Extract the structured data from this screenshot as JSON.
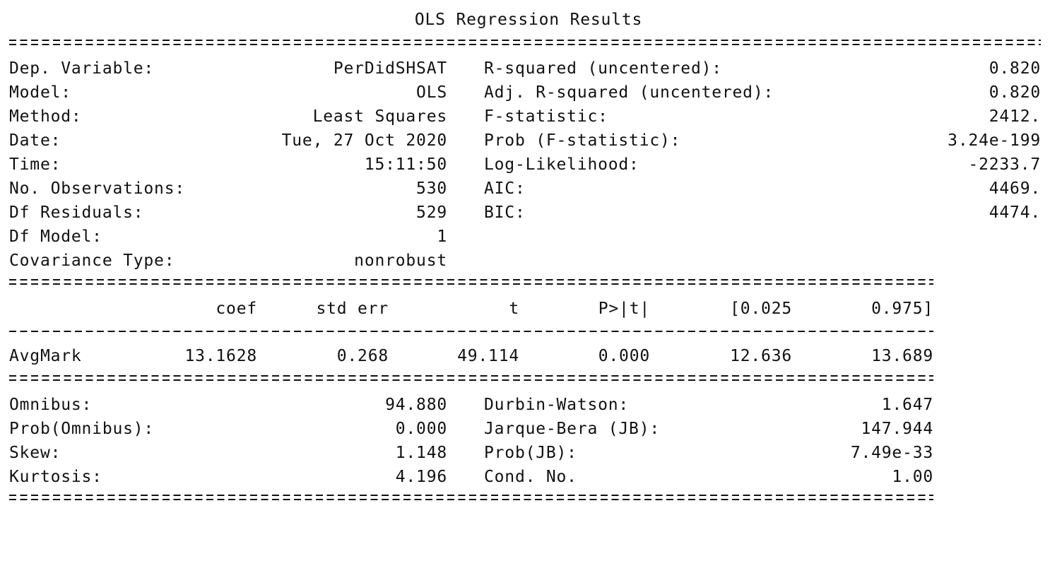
{
  "title": "OLS Regression Results",
  "model_info": {
    "left": [
      {
        "label": "Dep. Variable:",
        "value": "PerDidSHSAT"
      },
      {
        "label": "Model:",
        "value": "OLS"
      },
      {
        "label": "Method:",
        "value": "Least Squares"
      },
      {
        "label": "Date:",
        "value": "Tue, 27 Oct 2020"
      },
      {
        "label": "Time:",
        "value": "15:11:50"
      },
      {
        "label": "No. Observations:",
        "value": "530"
      },
      {
        "label": "Df Residuals:",
        "value": "529"
      },
      {
        "label": "Df Model:",
        "value": "1"
      },
      {
        "label": "Covariance Type:",
        "value": "nonrobust"
      }
    ],
    "right": [
      {
        "label": "R-squared (uncentered):",
        "value": "0.820"
      },
      {
        "label": "Adj. R-squared (uncentered):",
        "value": "0.820"
      },
      {
        "label": "F-statistic:",
        "value": "2412."
      },
      {
        "label": "Prob (F-statistic):",
        "value": "3.24e-199"
      },
      {
        "label": "Log-Likelihood:",
        "value": "-2233.7"
      },
      {
        "label": "AIC:",
        "value": "4469."
      },
      {
        "label": "BIC:",
        "value": "4474."
      }
    ]
  },
  "coef_table": {
    "headers": [
      "coef",
      "std err",
      "t",
      "P>|t|",
      "[0.025",
      "0.975]"
    ],
    "rows": [
      {
        "name": "AvgMark",
        "values": [
          "13.1628",
          "0.268",
          "49.114",
          "0.000",
          "12.636",
          "13.689"
        ]
      }
    ]
  },
  "diagnostics": {
    "left": [
      {
        "label": "Omnibus:",
        "value": "94.880"
      },
      {
        "label": "Prob(Omnibus):",
        "value": "0.000"
      },
      {
        "label": "Skew:",
        "value": "1.148"
      },
      {
        "label": "Kurtosis:",
        "value": "4.196"
      }
    ],
    "right": [
      {
        "label": "Durbin-Watson:",
        "value": "1.647"
      },
      {
        "label": "Jarque-Bera (JB):",
        "value": "147.944"
      },
      {
        "label": "Prob(JB):",
        "value": "7.49e-33"
      },
      {
        "label": "Cond. No.",
        "value": "1.00"
      }
    ]
  }
}
